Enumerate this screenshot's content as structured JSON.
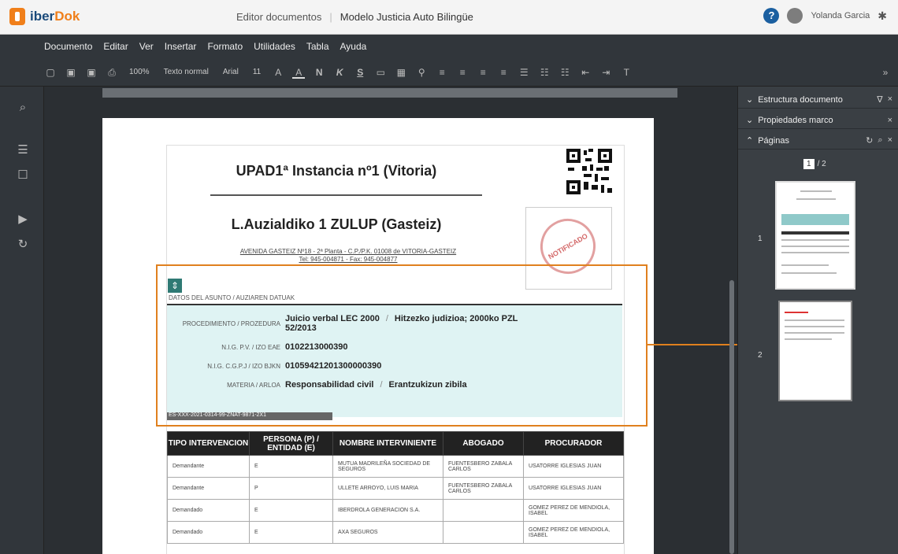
{
  "app": {
    "brand_a": "iber",
    "brand_b": "Dok"
  },
  "header": {
    "app_name": "Editor documentos",
    "separator": "|",
    "model_title": "Modelo Justicia Auto Bilingüe",
    "user_name": "Yolanda Garcia",
    "help_icon": "?"
  },
  "menu": [
    "Documento",
    "Editar",
    "Ver",
    "Insertar",
    "Formato",
    "Utilidades",
    "Tabla",
    "Ayuda"
  ],
  "toolbar": {
    "zoom": "100%",
    "style": "Texto normal",
    "font": "Arial",
    "size": "11",
    "bold": "N",
    "italic": "K",
    "underline": "S"
  },
  "document": {
    "court_es": "UPAD1ª Instancia nº1 (Vitoria)",
    "court_eu": "L.Auzialdiko 1 ZULUP (Gasteiz)",
    "address_line1": "AVENIDA GASTEIZ Nº18 - 2ª Planta - C.P./P.K. 01008 de VITORIA-GASTEIZ",
    "address_line2": "Tel: 945-004871 - Fax: 945-004877",
    "stamp": "NOTIFICADO",
    "data_header": "DATOS DEL ASUNTO  /  AUZIAREN DATUAK",
    "fields": [
      {
        "label": "PROCEDIMIENTO / PROZEDURA",
        "value": "Juicio verbal  LEC 2000",
        "value_alt": "Hitzezko judizioa; 2000ko PZL",
        "value2": "52/2013"
      },
      {
        "label": "N.I.G. P.V. / IZO EAE",
        "value": "0102213000390"
      },
      {
        "label": "N.I.G. C.G.P.J / IZO BJKN",
        "value": "01059421201300000390"
      },
      {
        "label": "MATERIA / ARLOA",
        "value": "Responsabilidad civil",
        "value_alt": "Erantzukizun zibila"
      }
    ],
    "url_band": "ES-XXX-2021-0314-99-ZNAT-9871-2X1",
    "move_handle": "⇕"
  },
  "table": {
    "headers": [
      "TIPO INTERVENCION",
      "PERSONA (P) / ENTIDAD (E)",
      "NOMBRE INTERVINIENTE",
      "ABOGADO",
      "PROCURADOR"
    ],
    "rows": [
      [
        "Demandante",
        "E",
        "MUTUA MADRILEÑA SOCIEDAD DE SEGUROS",
        "FUENTESBERO ZABALA CARLOS",
        "USATORRE IGLESIAS JUAN"
      ],
      [
        "Demandante",
        "P",
        "ULLETE ARROYO, LUIS MARIA",
        "FUENTESBERO ZABALA CARLOS",
        "USATORRE IGLESIAS JUAN"
      ],
      [
        "Demandado",
        "E",
        "IBERDROLA GENERACION S.A.",
        "",
        "GOMEZ PEREZ DE MENDIOLA, ISABEL"
      ],
      [
        "Demandado",
        "E",
        "AXA SEGUROS",
        "",
        "GOMEZ PEREZ DE MENDIOLA, ISABEL"
      ]
    ]
  },
  "right_panel": {
    "sections": [
      "Estructura documento",
      "Propiedades marco",
      "Páginas"
    ],
    "current_page": "1",
    "total_pages": "/ 2",
    "pages": [
      "1",
      "2"
    ]
  }
}
